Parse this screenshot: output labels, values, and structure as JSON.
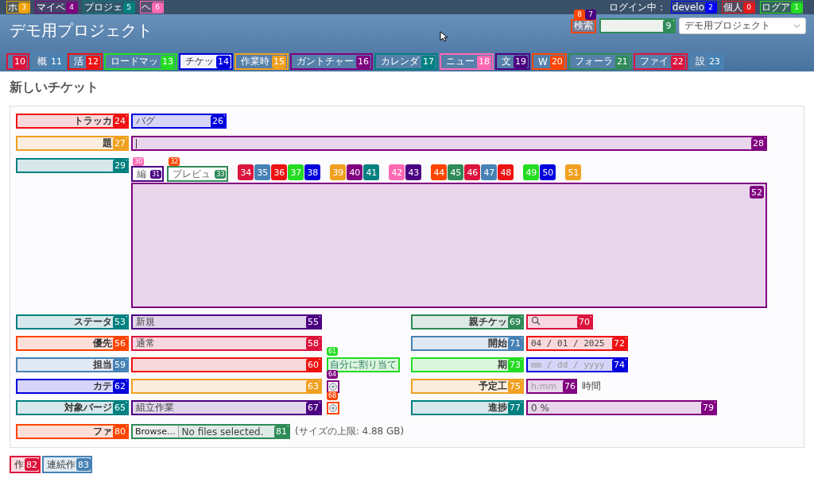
{
  "top_menu": {
    "left": [
      {
        "text": "ホ",
        "badge": "3",
        "color": "#f0a30a"
      },
      {
        "text": "マイペ",
        "badge": "4",
        "color": "#800080"
      },
      {
        "text": "プロジェ",
        "badge": "5",
        "color": "#008080"
      },
      {
        "text": "ヘ",
        "badge": "6",
        "color": "#ff69b4"
      }
    ],
    "login_label": "ログイン中：",
    "right": [
      {
        "text": "develo",
        "badge": "2",
        "color": "#0000ff"
      },
      {
        "text": "個人",
        "badge": "0",
        "color": "#e31a1c"
      },
      {
        "text": "ログア",
        "badge": "1",
        "color": "#22dd22"
      }
    ]
  },
  "header": {
    "title": "デモ用プロジェクト",
    "search": {
      "label": "検索",
      "color": "#ff4500",
      "badges": [
        {
          "badge": "8",
          "color": "#ff4500"
        },
        {
          "badge": "7",
          "color": "#4b0082"
        }
      ],
      "field": {
        "badge": "9",
        "color": "#2e8b57"
      }
    },
    "project_select": {
      "value": "デモ用プロジェクト"
    }
  },
  "tabs": [
    {
      "badge": "10",
      "color": "#dc143c",
      "selected": false
    },
    {
      "text": "概",
      "badge": "11",
      "color": "#4682b4",
      "selected": false
    },
    {
      "text": "活",
      "badge": "12",
      "color": "#ee1111",
      "selected": false
    },
    {
      "text": "ロードマッ",
      "badge": "13",
      "color": "#22dd22",
      "selected": false
    },
    {
      "text": "チケッ",
      "badge": "14",
      "color": "#0000dd",
      "selected": true
    },
    {
      "text": "作業時",
      "badge": "15",
      "color": "#f0a020",
      "selected": false
    },
    {
      "text": "ガントチャー",
      "badge": "16",
      "color": "#800080",
      "selected": false
    },
    {
      "text": "カレンダ",
      "badge": "17",
      "color": "#008080",
      "selected": false
    },
    {
      "text": "ニュー",
      "badge": "18",
      "color": "#ff69b4",
      "selected": false
    },
    {
      "text": "文",
      "badge": "19",
      "color": "#4b0082",
      "selected": false
    },
    {
      "text": "W",
      "badge": "20",
      "color": "#ff4500",
      "selected": false
    },
    {
      "text": "フォーラ",
      "badge": "21",
      "color": "#2e8b57",
      "selected": false
    },
    {
      "text": "ファイ",
      "badge": "22",
      "color": "#dc143c",
      "selected": false
    },
    {
      "text": "設",
      "badge": "23",
      "color": "#4682b4",
      "selected": false
    }
  ],
  "heading": "新しいチケット",
  "tracker": {
    "label": {
      "text": "トラッカ",
      "badge": "24",
      "color": "#ee1111"
    },
    "field": {
      "kind": "select",
      "value": "バグ",
      "badge": "26",
      "color": "#0000dd"
    }
  },
  "subject": {
    "label": {
      "text": "題",
      "badge": "27",
      "color": "#f0a020"
    },
    "field": {
      "kind": "text",
      "badge": "28",
      "color": "#800080"
    }
  },
  "description": {
    "label": {
      "badge": "29",
      "color": "#008080"
    },
    "tabs": [
      {
        "text": "編",
        "badge": "31",
        "color": "#4b0082",
        "over": {
          "badge": "30",
          "color": "#ff69b4"
        }
      },
      {
        "text": "プレビュ",
        "badge": "33",
        "color": "#2e8b57",
        "over": {
          "badge": "32",
          "color": "#ff4500"
        }
      }
    ],
    "button_groups": [
      [
        {
          "badge": "34",
          "color": "#dc143c"
        },
        {
          "badge": "35",
          "color": "#4682b4"
        },
        {
          "badge": "36",
          "color": "#ee1111"
        },
        {
          "badge": "37",
          "color": "#22dd22"
        },
        {
          "badge": "38",
          "color": "#0000dd"
        }
      ],
      [
        {
          "badge": "39",
          "color": "#f0a020"
        },
        {
          "badge": "40",
          "color": "#800080"
        },
        {
          "badge": "41",
          "color": "#008080"
        }
      ],
      [
        {
          "badge": "42",
          "color": "#ff69b4"
        },
        {
          "badge": "43",
          "color": "#4b0082"
        }
      ],
      [
        {
          "badge": "44",
          "color": "#ff4500"
        },
        {
          "badge": "45",
          "color": "#2e8b57"
        },
        {
          "badge": "46",
          "color": "#dc143c"
        },
        {
          "badge": "47",
          "color": "#4682b4"
        },
        {
          "badge": "48",
          "color": "#ee1111"
        }
      ],
      [
        {
          "badge": "49",
          "color": "#22dd22"
        },
        {
          "badge": "50",
          "color": "#0000dd"
        }
      ],
      [
        {
          "badge": "51",
          "color": "#f0a020"
        }
      ]
    ],
    "editor": {
      "badge": "52",
      "color": "#800080"
    }
  },
  "left_fields": [
    {
      "label": {
        "text": "ステータ",
        "badge": "53",
        "color": "#008080"
      },
      "field": {
        "kind": "select",
        "value": "新規",
        "badge": "55",
        "color": "#4b0082"
      }
    },
    {
      "label": {
        "text": "優先",
        "badge": "56",
        "color": "#ff4500"
      },
      "field": {
        "kind": "select",
        "value": "通常",
        "badge": "58",
        "color": "#dc143c"
      }
    },
    {
      "label": {
        "text": "担当",
        "badge": "59",
        "color": "#4682b4"
      },
      "field": {
        "kind": "select",
        "badge": "60",
        "color": "#ee1111"
      },
      "extra": {
        "kind": "link",
        "text": "自分に割り当て",
        "badge": "61",
        "color": "#22dd22"
      }
    },
    {
      "label": {
        "text": "カテ",
        "badge": "62",
        "color": "#0000dd"
      },
      "field": {
        "kind": "select",
        "badge": "63",
        "color": "#f0a020"
      },
      "extra": {
        "kind": "add",
        "badge": "64",
        "color": "#800080"
      }
    },
    {
      "label": {
        "text": "対象バージ",
        "badge": "65",
        "color": "#008080"
      },
      "field": {
        "kind": "select",
        "value": "組立作業",
        "badge": "67",
        "color": "#4b0082"
      },
      "extra": {
        "kind": "add",
        "badge": "68",
        "color": "#ff4500"
      }
    }
  ],
  "right_fields": [
    {
      "label": {
        "text": "親チケッ",
        "badge": "69",
        "color": "#2e8b57"
      },
      "field": {
        "kind": "search",
        "badge": "70",
        "color": "#dc143c"
      }
    },
    {
      "label": {
        "text": "開始",
        "badge": "71",
        "color": "#4682b4"
      },
      "field": {
        "kind": "date",
        "value": "04 / 01 / 2025",
        "badge": "72",
        "color": "#ee1111"
      }
    },
    {
      "label": {
        "text": "期",
        "badge": "73",
        "color": "#22dd22"
      },
      "field": {
        "kind": "date",
        "placeholder": "mm / dd / yyyy",
        "badge": "74",
        "color": "#0000dd"
      }
    },
    {
      "label": {
        "text": "予定工",
        "badge": "75",
        "color": "#f0a020"
      },
      "field": {
        "kind": "hours",
        "placeholder": "h:mm",
        "suffix": "時間",
        "badge": "76",
        "color": "#800080"
      }
    },
    {
      "label": {
        "text": "進捗",
        "badge": "77",
        "color": "#008080"
      },
      "field": {
        "kind": "percent",
        "value": "0 %",
        "badge": "79",
        "color": "#800080"
      }
    }
  ],
  "files": {
    "label": {
      "text": "ファ",
      "badge": "80",
      "color": "#ff4500"
    },
    "field": {
      "kind": "file",
      "button": "Browse...",
      "value": "No files selected.",
      "badge": "81",
      "color": "#2e8b57"
    },
    "note": "(サイズの上限: 4.88 GB)"
  },
  "buttons": [
    {
      "text": "作",
      "badge": "82",
      "color": "#dc143c"
    },
    {
      "text": "連続作",
      "badge": "83",
      "color": "#4682b4"
    }
  ]
}
